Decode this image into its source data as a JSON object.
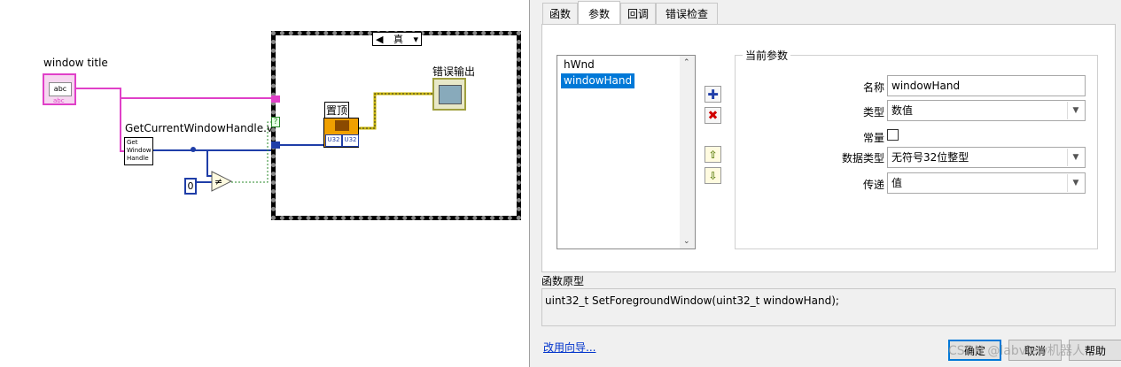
{
  "diagram": {
    "window_title_label": "window title",
    "string_const": "abc",
    "string_const_small": "abc",
    "getcurrent_label": "GetCurrentWindowHandle.vi",
    "getcurrent_icon_lines": [
      "Get",
      "Window",
      "Handle"
    ],
    "zero_const": "0",
    "not_equal_symbol": "≠",
    "case_selector": "真",
    "case_tunnel_q": "?",
    "topmost_label": "置顶",
    "topmost_terms": [
      "U32",
      "U32"
    ],
    "error_out_label": "错误输出",
    "colors": {
      "string_wire": "#e040c8",
      "int_wire": "#1f3ea8",
      "error_wire": "#c8b400",
      "bool_wire": "#2a8a2a"
    }
  },
  "dialog": {
    "tabs": [
      {
        "label": "函数",
        "active": false
      },
      {
        "label": "参数",
        "active": true
      },
      {
        "label": "回调",
        "active": false
      },
      {
        "label": "错误检查",
        "active": false
      }
    ],
    "param_list": [
      {
        "label": "hWnd",
        "selected": false
      },
      {
        "label": "windowHand",
        "selected": true
      }
    ],
    "add_icon": "plus-icon",
    "remove_icon": "x-icon",
    "move_up_icon": "arrow-up-icon",
    "move_down_icon": "arrow-down-icon",
    "group_title": "当前参数",
    "name_label": "名称",
    "name_value": "windowHand",
    "type_label": "类型",
    "type_value": "数值",
    "const_label": "常量",
    "datatype_label": "数据类型",
    "datatype_value": "无符号32位整型",
    "pass_label": "传递",
    "pass_value": "值",
    "prototype_label": "函数原型",
    "prototype_value": "uint32_t SetForegroundWindow(uint32_t windowHand);",
    "wizard_link": "改用向导...",
    "ok_button": "确定",
    "cancel_button": "取消",
    "help_button": "帮助",
    "watermark": "CSDN @labview机器人"
  }
}
